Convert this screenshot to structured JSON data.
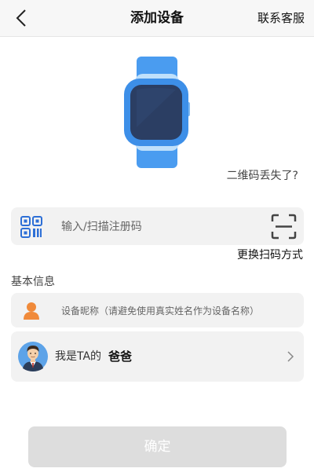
{
  "header": {
    "title": "添加设备",
    "service_label": "联系客服"
  },
  "device": {
    "image_icon": "smartwatch-icon",
    "lost_qr_link": "二维码丢失了?"
  },
  "registration": {
    "icon": "qr-code-icon",
    "placeholder": "输入/扫描注册码",
    "value": "",
    "scan_icon": "scan-icon",
    "switch_scan_label": "更换扫码方式"
  },
  "basic_info": {
    "section_title": "基本信息",
    "nickname_icon": "person-icon",
    "nickname_placeholder": "设备昵称（请避免使用真实姓名作为设备名称）",
    "nickname_value": "",
    "relation_prefix": "我是TA的",
    "relation_value": "爸爸",
    "relation_avatar": "dad-avatar"
  },
  "confirm_label": "确定",
  "colors": {
    "header_bg": "#f7f7f7",
    "field_bg": "#f2f2f2",
    "qr_icon_blue": "#2d6fd6",
    "person_orange": "#f08a3a",
    "watch_strap": "#3d8fe8",
    "watch_screen": "#2b3e63",
    "button_disabled": "#dddddd"
  }
}
